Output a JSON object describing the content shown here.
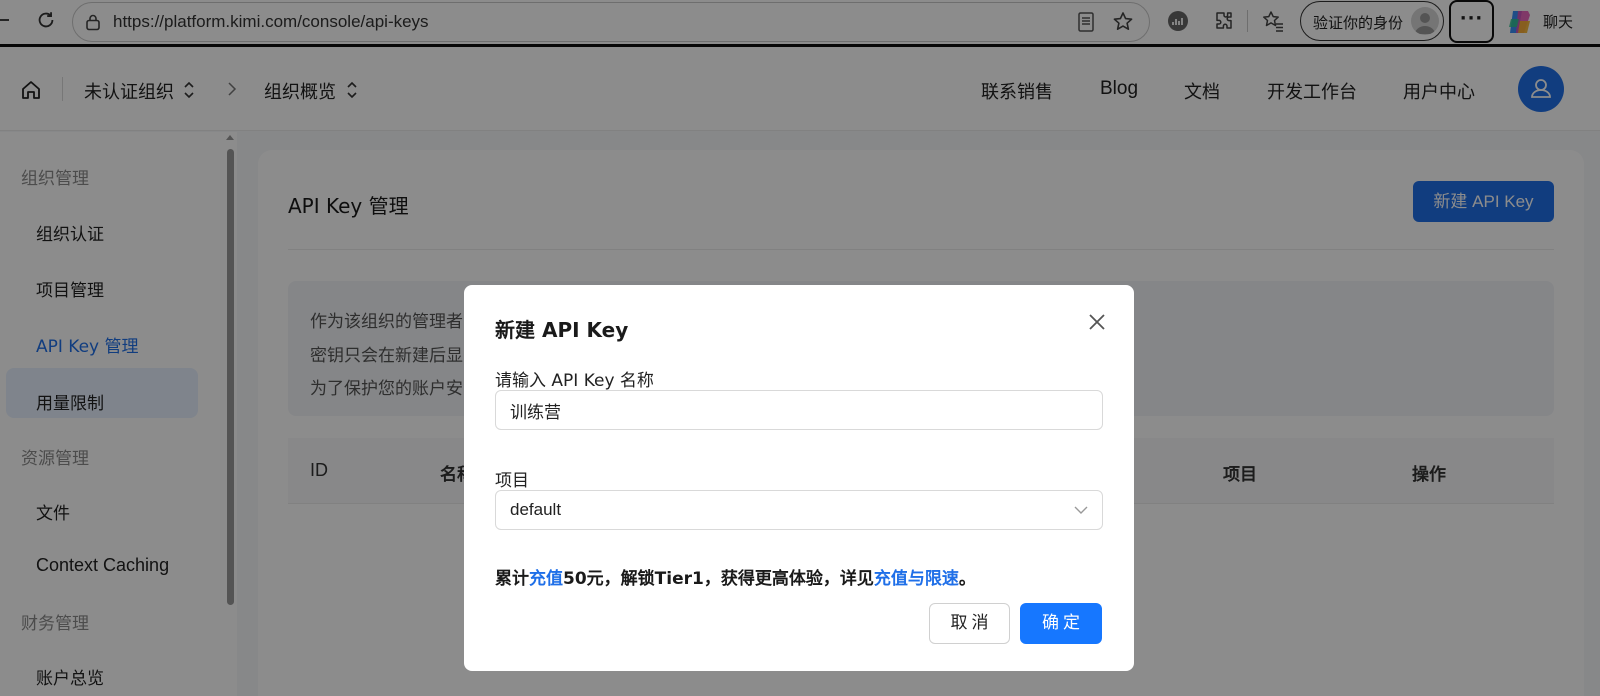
{
  "browser": {
    "url": "https://platform.kimi.com/console/api-keys",
    "verify_label": "验证你的身份",
    "more_label": "···",
    "chat_label": "聊天",
    "icons": [
      "back-icon",
      "reload-icon",
      "lock-icon",
      "reader-mode-icon",
      "favorite-star-icon",
      "extension-stats-icon",
      "extensions-puzzle-icon",
      "favorites-icon",
      "profile-avatar-icon",
      "copilot-icon"
    ]
  },
  "top_nav": {
    "org": "未认证组织",
    "overview": "组织概览",
    "links": [
      "联系销售",
      "Blog",
      "文档",
      "开发工作台",
      "用户中心"
    ]
  },
  "sidebar": {
    "groups": [
      {
        "label": "组织管理",
        "items": [
          "组织认证",
          "项目管理",
          "API Key 管理",
          "用量限制"
        ]
      },
      {
        "label": "资源管理",
        "items": [
          "文件",
          "Context Caching"
        ]
      },
      {
        "label": "财务管理",
        "items": [
          "账户总览"
        ]
      }
    ],
    "active_item": "API Key 管理"
  },
  "main": {
    "title": "API Key 管理",
    "new_button": "新建 API Key",
    "info_lines": [
      "作为该组织的管理者",
      "密钥只会在新建后显",
      "为了保护您的账户安"
    ],
    "table_headers": [
      "ID",
      "名称",
      "项目",
      "操作"
    ]
  },
  "modal": {
    "title": "新建 API Key",
    "name_label": "请输入 API Key 名称",
    "name_value": "训练营",
    "project_label": "项目",
    "project_value": "default",
    "hint": {
      "prefix": "累计",
      "link1": "充值",
      "middle": "50元，解锁Tier1，获得更高体验，详见",
      "link2": "充值与限速",
      "suffix": "。"
    },
    "cancel_label": "取消",
    "ok_label": "确定"
  },
  "colors": {
    "accent": "#1f6fe8",
    "primary_button": "#1677ff",
    "overlay": "rgba(0,0,0,0.45)"
  }
}
